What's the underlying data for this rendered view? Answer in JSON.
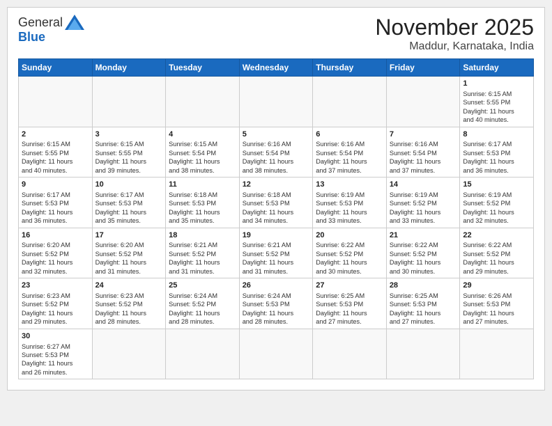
{
  "header": {
    "logo_general": "General",
    "logo_blue": "Blue",
    "month_title": "November 2025",
    "location": "Maddur, Karnataka, India"
  },
  "days_of_week": [
    "Sunday",
    "Monday",
    "Tuesday",
    "Wednesday",
    "Thursday",
    "Friday",
    "Saturday"
  ],
  "weeks": [
    [
      {
        "day": "",
        "info": ""
      },
      {
        "day": "",
        "info": ""
      },
      {
        "day": "",
        "info": ""
      },
      {
        "day": "",
        "info": ""
      },
      {
        "day": "",
        "info": ""
      },
      {
        "day": "",
        "info": ""
      },
      {
        "day": "1",
        "info": "Sunrise: 6:15 AM\nSunset: 5:55 PM\nDaylight: 11 hours\nand 40 minutes."
      }
    ],
    [
      {
        "day": "2",
        "info": "Sunrise: 6:15 AM\nSunset: 5:55 PM\nDaylight: 11 hours\nand 40 minutes."
      },
      {
        "day": "3",
        "info": "Sunrise: 6:15 AM\nSunset: 5:55 PM\nDaylight: 11 hours\nand 39 minutes."
      },
      {
        "day": "4",
        "info": "Sunrise: 6:15 AM\nSunset: 5:54 PM\nDaylight: 11 hours\nand 38 minutes."
      },
      {
        "day": "5",
        "info": "Sunrise: 6:16 AM\nSunset: 5:54 PM\nDaylight: 11 hours\nand 38 minutes."
      },
      {
        "day": "6",
        "info": "Sunrise: 6:16 AM\nSunset: 5:54 PM\nDaylight: 11 hours\nand 37 minutes."
      },
      {
        "day": "7",
        "info": "Sunrise: 6:16 AM\nSunset: 5:54 PM\nDaylight: 11 hours\nand 37 minutes."
      },
      {
        "day": "8",
        "info": "Sunrise: 6:17 AM\nSunset: 5:53 PM\nDaylight: 11 hours\nand 36 minutes."
      }
    ],
    [
      {
        "day": "9",
        "info": "Sunrise: 6:17 AM\nSunset: 5:53 PM\nDaylight: 11 hours\nand 36 minutes."
      },
      {
        "day": "10",
        "info": "Sunrise: 6:17 AM\nSunset: 5:53 PM\nDaylight: 11 hours\nand 35 minutes."
      },
      {
        "day": "11",
        "info": "Sunrise: 6:18 AM\nSunset: 5:53 PM\nDaylight: 11 hours\nand 35 minutes."
      },
      {
        "day": "12",
        "info": "Sunrise: 6:18 AM\nSunset: 5:53 PM\nDaylight: 11 hours\nand 34 minutes."
      },
      {
        "day": "13",
        "info": "Sunrise: 6:19 AM\nSunset: 5:53 PM\nDaylight: 11 hours\nand 33 minutes."
      },
      {
        "day": "14",
        "info": "Sunrise: 6:19 AM\nSunset: 5:52 PM\nDaylight: 11 hours\nand 33 minutes."
      },
      {
        "day": "15",
        "info": "Sunrise: 6:19 AM\nSunset: 5:52 PM\nDaylight: 11 hours\nand 32 minutes."
      }
    ],
    [
      {
        "day": "16",
        "info": "Sunrise: 6:20 AM\nSunset: 5:52 PM\nDaylight: 11 hours\nand 32 minutes."
      },
      {
        "day": "17",
        "info": "Sunrise: 6:20 AM\nSunset: 5:52 PM\nDaylight: 11 hours\nand 31 minutes."
      },
      {
        "day": "18",
        "info": "Sunrise: 6:21 AM\nSunset: 5:52 PM\nDaylight: 11 hours\nand 31 minutes."
      },
      {
        "day": "19",
        "info": "Sunrise: 6:21 AM\nSunset: 5:52 PM\nDaylight: 11 hours\nand 31 minutes."
      },
      {
        "day": "20",
        "info": "Sunrise: 6:22 AM\nSunset: 5:52 PM\nDaylight: 11 hours\nand 30 minutes."
      },
      {
        "day": "21",
        "info": "Sunrise: 6:22 AM\nSunset: 5:52 PM\nDaylight: 11 hours\nand 30 minutes."
      },
      {
        "day": "22",
        "info": "Sunrise: 6:22 AM\nSunset: 5:52 PM\nDaylight: 11 hours\nand 29 minutes."
      }
    ],
    [
      {
        "day": "23",
        "info": "Sunrise: 6:23 AM\nSunset: 5:52 PM\nDaylight: 11 hours\nand 29 minutes."
      },
      {
        "day": "24",
        "info": "Sunrise: 6:23 AM\nSunset: 5:52 PM\nDaylight: 11 hours\nand 28 minutes."
      },
      {
        "day": "25",
        "info": "Sunrise: 6:24 AM\nSunset: 5:52 PM\nDaylight: 11 hours\nand 28 minutes."
      },
      {
        "day": "26",
        "info": "Sunrise: 6:24 AM\nSunset: 5:53 PM\nDaylight: 11 hours\nand 28 minutes."
      },
      {
        "day": "27",
        "info": "Sunrise: 6:25 AM\nSunset: 5:53 PM\nDaylight: 11 hours\nand 27 minutes."
      },
      {
        "day": "28",
        "info": "Sunrise: 6:25 AM\nSunset: 5:53 PM\nDaylight: 11 hours\nand 27 minutes."
      },
      {
        "day": "29",
        "info": "Sunrise: 6:26 AM\nSunset: 5:53 PM\nDaylight: 11 hours\nand 27 minutes."
      }
    ],
    [
      {
        "day": "30",
        "info": "Sunrise: 6:27 AM\nSunset: 5:53 PM\nDaylight: 11 hours\nand 26 minutes."
      },
      {
        "day": "",
        "info": ""
      },
      {
        "day": "",
        "info": ""
      },
      {
        "day": "",
        "info": ""
      },
      {
        "day": "",
        "info": ""
      },
      {
        "day": "",
        "info": ""
      },
      {
        "day": "",
        "info": ""
      }
    ]
  ]
}
